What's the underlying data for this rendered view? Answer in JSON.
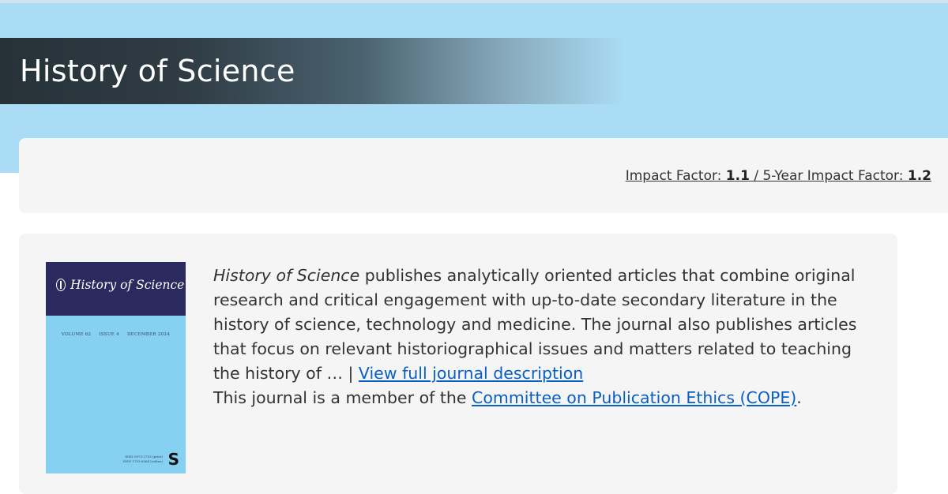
{
  "header": {
    "title": "History of Science"
  },
  "metrics": {
    "impact_factor_label": "Impact Factor: ",
    "impact_factor_value": "1.1",
    "separator": " / ",
    "five_year_label": "5-Year Impact Factor: ",
    "five_year_value": "1.2"
  },
  "cover": {
    "title": "History of Science",
    "volume": "VOLUME 62",
    "issue": "ISSUE 4",
    "date": "DECEMBER 2024",
    "issn_print": "ISSN 0073-2753 (print)",
    "issn_online": "ISSN 1753-8564 (online)",
    "publisher_logo": "S",
    "icon": "journal-cover-image"
  },
  "description": {
    "journal_name": "History of Science",
    "text": " publishes analytically oriented articles that combine original research and critical engagement with up-to-date secondary literature in the history of science, technology and medicine. The journal also publishes articles that focus on relevant historiographical issues and matters related to teaching the history of … | ",
    "view_link": "View full journal description",
    "cope_prefix": "This journal is a member of the ",
    "cope_link": "Committee on Publication Ethics (COPE)",
    "cope_suffix": "."
  },
  "colors": {
    "hero_band": "#aadcf5",
    "title_bar": "#263238",
    "panel": "#f5f5f5",
    "link": "#0a5fc4",
    "cover_head": "#2b2a5e",
    "cover_body": "#86d0f2"
  }
}
